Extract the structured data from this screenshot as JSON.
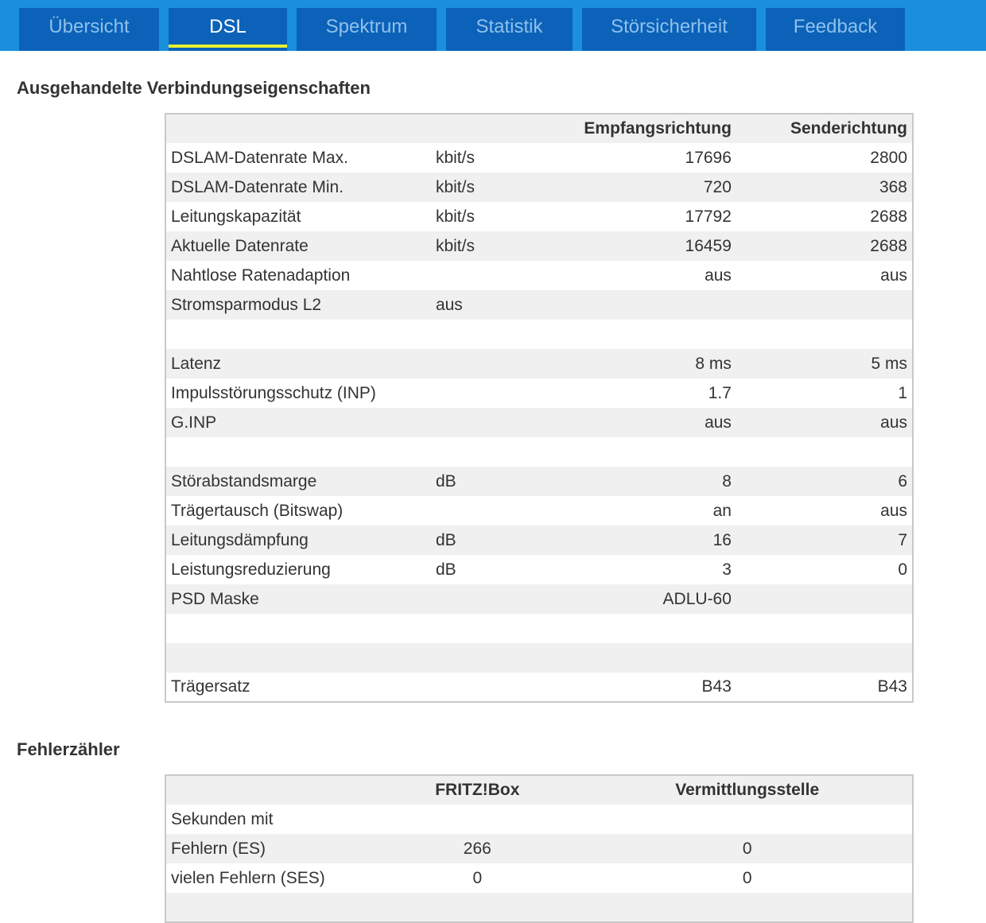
{
  "tabs": [
    {
      "label": "Übersicht",
      "active": false
    },
    {
      "label": "DSL",
      "active": true
    },
    {
      "label": "Spektrum",
      "active": false
    },
    {
      "label": "Statistik",
      "active": false
    },
    {
      "label": "Störsicherheit",
      "active": false
    },
    {
      "label": "Feedback",
      "active": false
    }
  ],
  "colors": {
    "tabbar": "#1a8fdb",
    "tab": "#0b62b8",
    "active_underline": "#e8f030"
  },
  "connection": {
    "title": "Ausgehandelte Verbindungseigenschaften",
    "headers": [
      "",
      "",
      "Empfangsrichtung",
      "Senderichtung"
    ],
    "rows": [
      [
        "DSLAM-Datenrate Max.",
        "kbit/s",
        "17696",
        "2800"
      ],
      [
        "DSLAM-Datenrate Min.",
        "kbit/s",
        "720",
        "368"
      ],
      [
        "Leitungskapazität",
        "kbit/s",
        "17792",
        "2688"
      ],
      [
        "Aktuelle Datenrate",
        "kbit/s",
        "16459",
        "2688"
      ],
      [
        "Nahtlose Ratenadaption",
        "",
        "aus",
        "aus"
      ],
      [
        "Stromsparmodus L2",
        "aus",
        "",
        ""
      ],
      [
        "",
        "",
        "",
        ""
      ],
      [
        "Latenz",
        "",
        "8 ms",
        "5 ms"
      ],
      [
        "Impulsstörungsschutz (INP)",
        "",
        "1.7",
        "1"
      ],
      [
        "G.INP",
        "",
        "aus",
        "aus"
      ],
      [
        "",
        "",
        "",
        ""
      ],
      [
        "Störabstandsmarge",
        "dB",
        "8",
        "6"
      ],
      [
        "Trägertausch (Bitswap)",
        "",
        "an",
        "aus"
      ],
      [
        "Leitungsdämpfung",
        "dB",
        "16",
        "7"
      ],
      [
        "Leistungsreduzierung",
        "dB",
        "3",
        "0"
      ],
      [
        "PSD Maske",
        "",
        "ADLU-60",
        ""
      ],
      [
        "",
        "",
        "",
        ""
      ],
      [
        "",
        "",
        "",
        ""
      ],
      [
        "Trägersatz",
        "",
        "B43",
        "B43"
      ]
    ]
  },
  "errors": {
    "title": "Fehlerzähler",
    "headers": [
      "",
      "FRITZ!Box",
      "Vermittlungsstelle"
    ],
    "rows": [
      [
        "Sekunden mit",
        "",
        ""
      ],
      [
        "Fehlern (ES)",
        "266",
        "0"
      ],
      [
        "vielen Fehlern (SES)",
        "0",
        "0"
      ],
      [
        "",
        "",
        ""
      ]
    ]
  }
}
